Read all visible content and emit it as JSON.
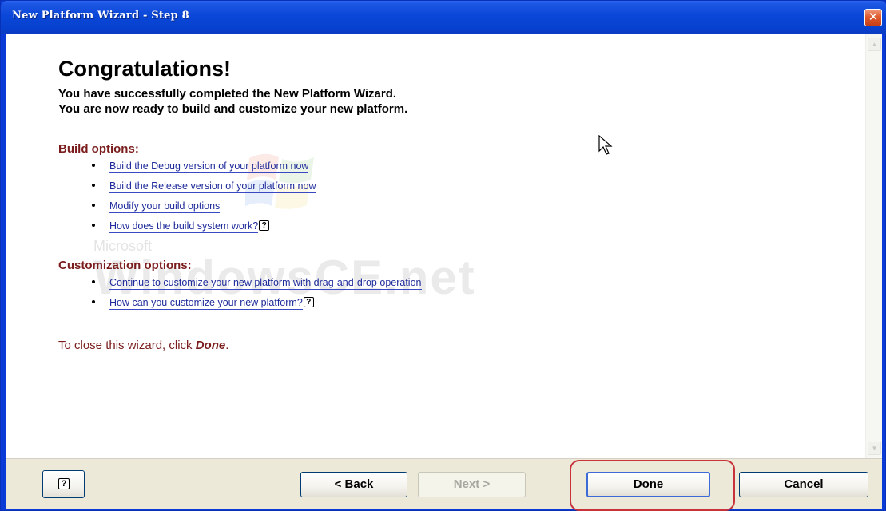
{
  "window": {
    "title": "New Platform Wizard - Step 8",
    "close_glyph": "✕"
  },
  "content": {
    "heading": "Congratulations!",
    "line1": "You have successfully completed the New Platform Wizard.",
    "line2": "You are now ready to build and customize your new platform.",
    "watermark_brand": "Microsoft",
    "watermark_product": "WindowsCE.net",
    "build_options": {
      "title": "Build options:",
      "items": [
        {
          "label": "Build the Debug version of your platform now",
          "help": false
        },
        {
          "label": "Build the Release version of your platform now",
          "help": false
        },
        {
          "label": "Modify your build options",
          "help": false
        },
        {
          "label": "How does the build system work?",
          "help": true
        }
      ]
    },
    "customization_options": {
      "title": "Customization options:",
      "items": [
        {
          "label": "Continue to customize your new platform with drag-and-drop operation",
          "help": false
        },
        {
          "label": "How can you customize your new platform?",
          "help": true
        }
      ]
    },
    "close_prefix": "To close this wizard, click ",
    "close_done": "Done",
    "close_suffix": ".",
    "help_glyph": "?"
  },
  "footer": {
    "help_glyph": "?",
    "back_prefix": "< ",
    "back_mnemonic": "B",
    "back_rest": "ack",
    "next_mnemonic": "N",
    "next_rest": "ext >",
    "done_mnemonic": "D",
    "done_rest": "one",
    "cancel_label": "Cancel"
  },
  "colors": {
    "title_bar": "#0a47d8",
    "section_heading": "#7a1c1c",
    "link": "#1f2c9b",
    "highlight": "#c9323a"
  },
  "icons": {
    "close": "close-icon",
    "help": "help-icon",
    "scroll_up": "scroll-up-arrow-icon",
    "scroll_down": "scroll-down-arrow-icon",
    "cursor": "mouse-cursor-icon"
  }
}
